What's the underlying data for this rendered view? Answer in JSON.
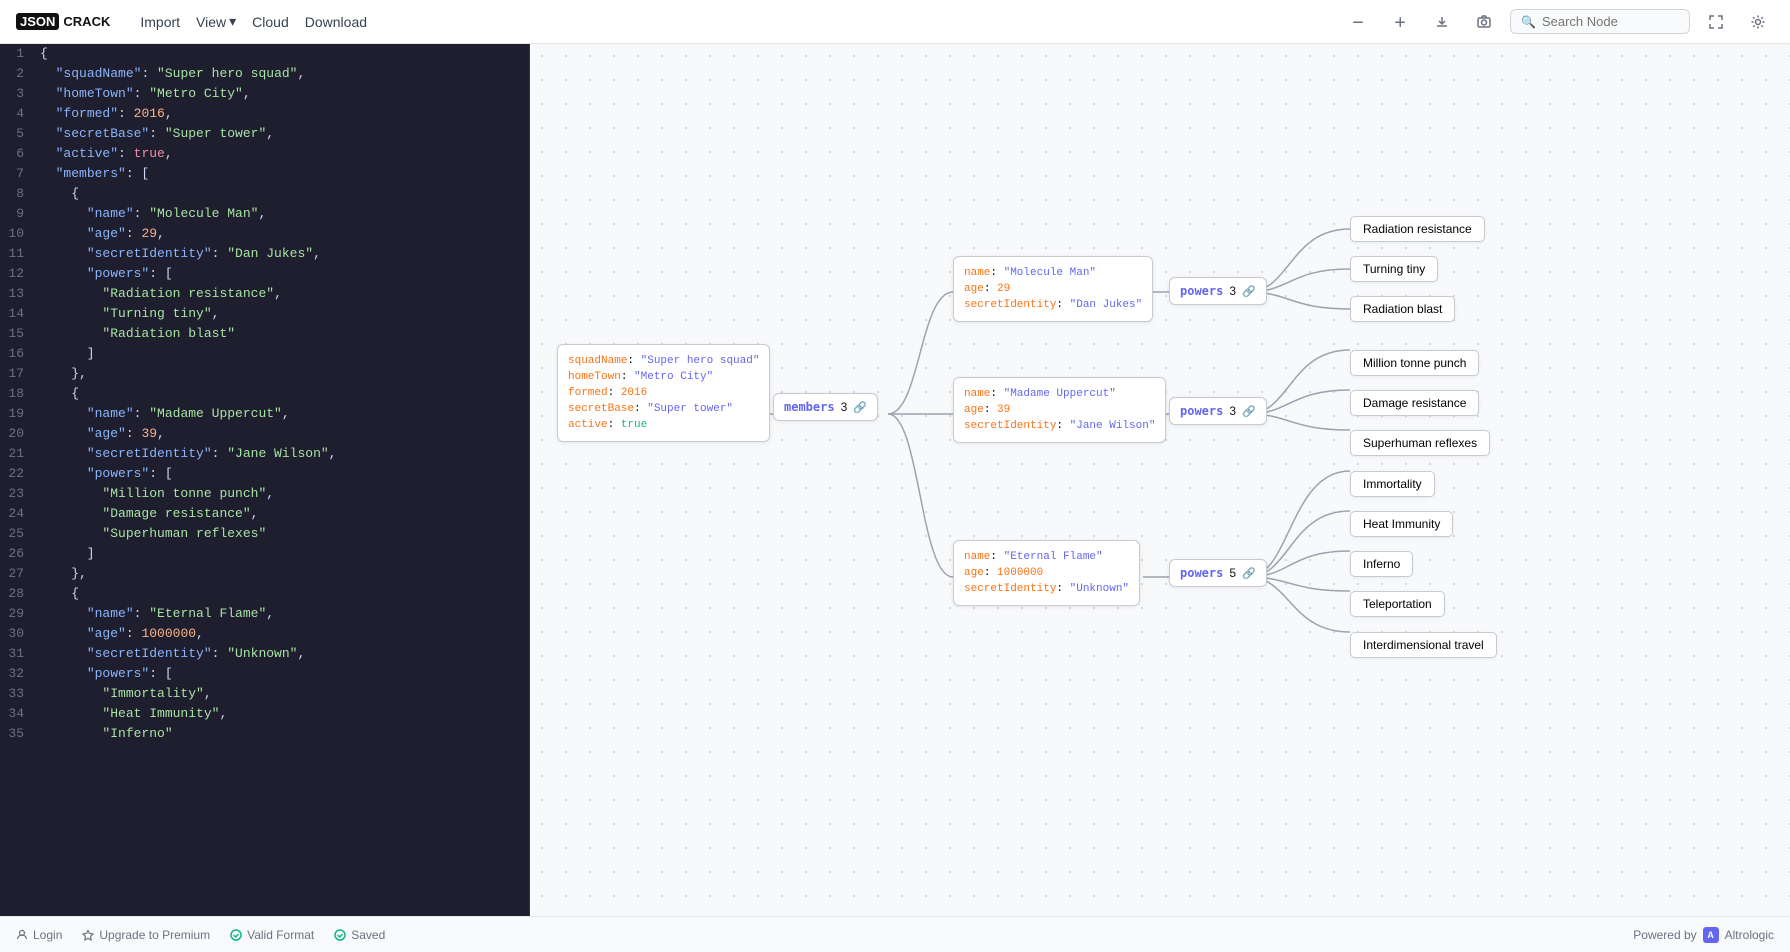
{
  "header": {
    "logo_json": "JSON",
    "logo_crack": "CRACK",
    "nav": [
      {
        "label": "Import",
        "id": "import"
      },
      {
        "label": "View",
        "id": "view",
        "arrow": true
      },
      {
        "label": "Cloud",
        "id": "cloud"
      },
      {
        "label": "Download",
        "id": "download"
      }
    ],
    "search_placeholder": "Search Node"
  },
  "editor": {
    "lines": [
      {
        "num": 1,
        "content": "{",
        "type": "brace"
      },
      {
        "num": 2,
        "content": "  \"squadName\": \"Super hero squad\",",
        "type": "kv",
        "key": "squadName",
        "val": "Super hero squad"
      },
      {
        "num": 3,
        "content": "  \"homeTown\": \"Metro City\",",
        "type": "kv",
        "key": "homeTown",
        "val": "Metro City"
      },
      {
        "num": 4,
        "content": "  \"formed\": 2016,",
        "type": "kv-num",
        "key": "formed",
        "val": "2016"
      },
      {
        "num": 5,
        "content": "  \"secretBase\": \"Super tower\",",
        "type": "kv",
        "key": "secretBase",
        "val": "Super tower"
      },
      {
        "num": 6,
        "content": "  \"active\": true,",
        "type": "kv-bool",
        "key": "active",
        "val": "true"
      },
      {
        "num": 7,
        "content": "  \"members\": [",
        "type": "arr-open",
        "key": "members"
      },
      {
        "num": 8,
        "content": "    {",
        "type": "brace"
      },
      {
        "num": 9,
        "content": "      \"name\": \"Molecule Man\",",
        "type": "kv",
        "key": "name",
        "val": "Molecule Man"
      },
      {
        "num": 10,
        "content": "      \"age\": 29,",
        "type": "kv-num",
        "key": "age",
        "val": "29"
      },
      {
        "num": 11,
        "content": "      \"secretIdentity\": \"Dan Jukes\",",
        "type": "kv",
        "key": "secretIdentity",
        "val": "Dan Jukes"
      },
      {
        "num": 12,
        "content": "      \"powers\": [",
        "type": "arr-open",
        "key": "powers"
      },
      {
        "num": 13,
        "content": "        \"Radiation resistance\",",
        "type": "str-val",
        "val": "Radiation resistance"
      },
      {
        "num": 14,
        "content": "        \"Turning tiny\",",
        "type": "str-val",
        "val": "Turning tiny"
      },
      {
        "num": 15,
        "content": "        \"Radiation blast\"",
        "type": "str-val",
        "val": "Radiation blast"
      },
      {
        "num": 16,
        "content": "      ]",
        "type": "brace"
      },
      {
        "num": 17,
        "content": "    },",
        "type": "brace"
      },
      {
        "num": 18,
        "content": "    {",
        "type": "brace"
      },
      {
        "num": 19,
        "content": "      \"name\": \"Madame Uppercut\",",
        "type": "kv",
        "key": "name",
        "val": "Madame Uppercut"
      },
      {
        "num": 20,
        "content": "      \"age\": 39,",
        "type": "kv-num",
        "key": "age",
        "val": "39"
      },
      {
        "num": 21,
        "content": "      \"secretIdentity\": \"Jane Wilson\",",
        "type": "kv",
        "key": "secretIdentity",
        "val": "Jane Wilson"
      },
      {
        "num": 22,
        "content": "      \"powers\": [",
        "type": "arr-open",
        "key": "powers"
      },
      {
        "num": 23,
        "content": "        \"Million tonne punch\",",
        "type": "str-val",
        "val": "Million tonne punch"
      },
      {
        "num": 24,
        "content": "        \"Damage resistance\",",
        "type": "str-val",
        "val": "Damage resistance"
      },
      {
        "num": 25,
        "content": "        \"Superhuman reflexes\"",
        "type": "str-val",
        "val": "Superhuman reflexes"
      },
      {
        "num": 26,
        "content": "      ]",
        "type": "brace"
      },
      {
        "num": 27,
        "content": "    },",
        "type": "brace"
      },
      {
        "num": 28,
        "content": "    {",
        "type": "brace"
      },
      {
        "num": 29,
        "content": "      \"name\": \"Eternal Flame\",",
        "type": "kv",
        "key": "name",
        "val": "Eternal Flame"
      },
      {
        "num": 30,
        "content": "      \"age\": 1000000,",
        "type": "kv-num",
        "key": "age",
        "val": "1000000"
      },
      {
        "num": 31,
        "content": "      \"secretIdentity\": \"Unknown\",",
        "type": "kv",
        "key": "secretIdentity",
        "val": "Unknown"
      },
      {
        "num": 32,
        "content": "      \"powers\": [",
        "type": "arr-open",
        "key": "powers"
      },
      {
        "num": 33,
        "content": "        \"Immortality\",",
        "type": "str-val",
        "val": "Immortality"
      },
      {
        "num": 34,
        "content": "        \"Heat Immunity\",",
        "type": "str-val",
        "val": "Heat Immunity"
      },
      {
        "num": 35,
        "content": "        \"...",
        "type": "str-val",
        "val": "..."
      }
    ]
  },
  "graph": {
    "root": {
      "squadName": "Super hero squad",
      "homeTown": "Metro City",
      "formed": "2016",
      "secretBase": "Super tower",
      "active": "true"
    },
    "members_label": "members",
    "members_count": "3",
    "member1": {
      "name": "Molecule Man",
      "age": "29",
      "secretIdentity": "Dan Jukes"
    },
    "member2": {
      "name": "Madame Uppercut",
      "age": "39",
      "secretIdentity": "Jane Wilson"
    },
    "member3": {
      "name": "Eternal Flame",
      "age": "1000000",
      "secretIdentity": "Unknown"
    },
    "powers1": {
      "label": "powers",
      "count": "3"
    },
    "powers2": {
      "label": "powers",
      "count": "3"
    },
    "powers3": {
      "label": "powers",
      "count": "5"
    },
    "leaves1": [
      "Radiation resistance",
      "Turning tiny",
      "Radiation blast"
    ],
    "leaves2": [
      "Million tonne punch",
      "Damage resistance",
      "Superhuman reflexes"
    ],
    "leaves3": [
      "Immortality",
      "Heat Immunity",
      "Inferno",
      "Teleportation",
      "Interdimensional travel"
    ]
  },
  "footer": {
    "login": "Login",
    "upgrade": "Upgrade to Premium",
    "valid_format": "Valid Format",
    "saved": "Saved",
    "powered_by": "Powered by",
    "altrologic": "Altrologic"
  }
}
